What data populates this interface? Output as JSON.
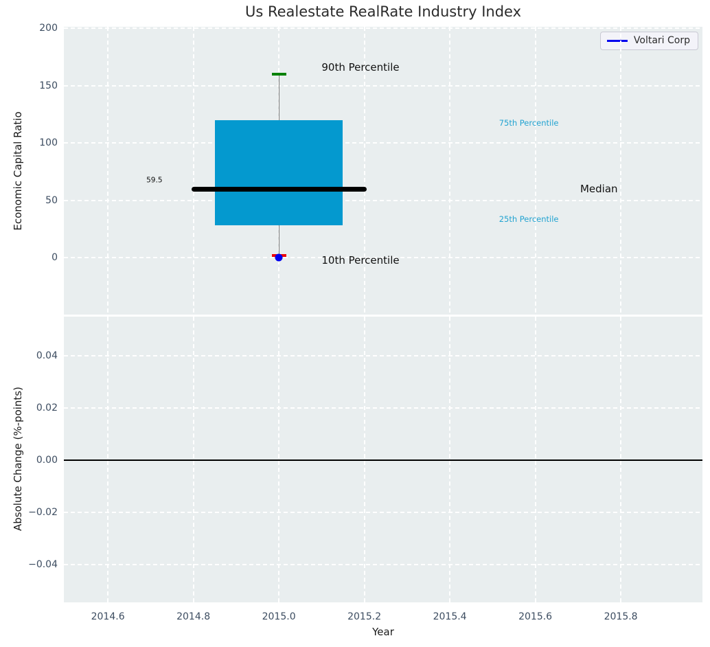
{
  "title": "Us Realestate RealRate Industry Index",
  "legend": {
    "label": "Voltari Corp"
  },
  "colors": {
    "axes_bg": "#e9eeef",
    "grid": "#ffffff",
    "box_fill": "#0499cf",
    "median_line": "#000000",
    "whisker": "#7a7a7a",
    "cap_90": "#008000",
    "cap_10": "#ee0000",
    "marker": "#0000ee",
    "legend_line": "#0000ee",
    "tick_label": "#3c4c60",
    "axis_label": "#1a1a1a",
    "title_color": "#2b2b2b",
    "percentile_text": "#22a3d1",
    "annotation_text": "#111111",
    "zero_line": "#000000"
  },
  "chart_data": {
    "type": "box",
    "title": "Us Realestate RealRate Industry Index",
    "xlabel": "Year",
    "xlim": [
      2014.497,
      2015.991
    ],
    "xticks": [
      2014.6,
      2014.8,
      2015.0,
      2015.2,
      2015.4,
      2015.6,
      2015.8
    ],
    "grid": {
      "color": "#ffffff",
      "style": "dashed",
      "enabled": true
    },
    "legend": {
      "position": "upper right",
      "entries": [
        {
          "label": "Voltari Corp",
          "color": "#0000ee"
        }
      ]
    },
    "subplots": [
      {
        "ylabel": "Economic Capital Ratio",
        "ylim": [
          -49.7,
          201.2
        ],
        "yticks": [
          0,
          50,
          100,
          150,
          200
        ],
        "boxplot": {
          "x": 2015.0,
          "p10": 2,
          "p25": 28,
          "median": 59.5,
          "p75": 120,
          "p90": 160,
          "box_half_width": 0.15,
          "median_half_width": 0.205,
          "cap_half_width": 0.017
        },
        "point": {
          "series": "Voltari Corp",
          "x": 2015.0,
          "y": 0
        },
        "annotations": [
          {
            "name": "p90-label",
            "text": "90th Percentile",
            "x": 2015.1,
            "y": 166,
            "size": 15,
            "color_key": "annotation_text"
          },
          {
            "name": "p10-label",
            "text": "10th Percentile",
            "x": 2015.1,
            "y": -2.5,
            "size": 15,
            "color_key": "annotation_text"
          },
          {
            "name": "p75-label",
            "text": "75th Percentile",
            "x": 2015.515,
            "y": 117,
            "size": 11.5,
            "color_key": "percentile_text"
          },
          {
            "name": "p25-label",
            "text": "25th Percentile",
            "x": 2015.515,
            "y": 33,
            "size": 11.5,
            "color_key": "percentile_text"
          },
          {
            "name": "median-label",
            "text": "Median",
            "x": 2015.705,
            "y": 60,
            "size": 15,
            "color_key": "annotation_text"
          },
          {
            "name": "median-value-label",
            "text": "59.5",
            "x": 2014.69,
            "y": 67,
            "size": 10.5,
            "color_key": "annotation_text"
          }
        ]
      },
      {
        "ylabel": "Absolute Change (%-points)",
        "ylim": [
          -0.0545,
          0.055
        ],
        "yticks": [
          0.04,
          0.02,
          0.0,
          -0.02,
          -0.04
        ],
        "zero_line": 0.0
      }
    ]
  }
}
